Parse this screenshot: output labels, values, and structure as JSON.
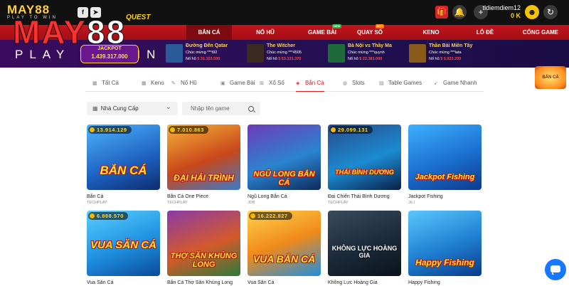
{
  "header": {
    "logo_top": "MAY88",
    "logo_bottom": "PLAY TO WIN",
    "facebook_icon": "f",
    "telegram_icon": "➤",
    "username": "tldiemdiem12",
    "balance": "0 K",
    "gift_icon": "🎁",
    "bell_icon": "🔔",
    "plus_icon": "+",
    "avatar_icon": "☻",
    "logout_icon": "↻"
  },
  "nav": {
    "quest": "QUEST",
    "items": [
      {
        "label": "BẮN CÁ",
        "active": true
      },
      {
        "label": "NỔ HŨ"
      },
      {
        "label": "GAME BÀI",
        "badge": "NEW"
      },
      {
        "label": "QUAY SỐ",
        "badge": "HOT"
      },
      {
        "label": "KENO"
      },
      {
        "label": "LÔ ĐỀ"
      },
      {
        "label": "CỔNG GAME"
      }
    ]
  },
  "brand": {
    "big_a": "MAY",
    "big_b": "88",
    "big_sub": "PLAY TO WIN"
  },
  "jackpot": {
    "label": "JACKPOT",
    "value": "1.439.317.000"
  },
  "winners": [
    {
      "title": "Đường Đến Qatar",
      "user": "Chúc mừng ***t92",
      "prefix": "Nổ hũ",
      "amount": "$ 31.103.500",
      "color": "#2a5a9a"
    },
    {
      "title": "The Witcher",
      "user": "Chúc mừng ***4505",
      "prefix": "Nổ hũ",
      "amount": "$ 53.131.370",
      "color": "#3a2a20"
    },
    {
      "title": "Bà Nội vs Thầy Ma",
      "user": "Chúc mừng ***quynh",
      "prefix": "Nổ hũ",
      "amount": "$ 22.381.000",
      "color": "#1f6a3a"
    },
    {
      "title": "Thần Bài Miền Tây",
      "user": "Chúc mừng ***lata",
      "prefix": "Nổ hũ",
      "amount": "$ 5.923.230",
      "color": "#8a5a1a"
    }
  ],
  "tabs": [
    {
      "label": "Tất Cả",
      "icon": "▦"
    },
    {
      "label": "Keno",
      "icon": "▦"
    },
    {
      "label": "Nổ Hũ",
      "icon": "✎"
    },
    {
      "label": "Game Bài",
      "icon": "▣"
    },
    {
      "label": "Xổ Số",
      "icon": "⊞"
    },
    {
      "label": "Bắn Cá",
      "icon": "◈",
      "active": true
    },
    {
      "label": "Slots",
      "icon": "◍"
    },
    {
      "label": "Table Games",
      "icon": "▤"
    },
    {
      "label": "Game Nhanh",
      "icon": "➹"
    }
  ],
  "filters": {
    "provider_label": "Nhà Cung Cấp",
    "provider_icon": "▦",
    "chevron_icon": "⌄",
    "search_placeholder": "Nhập tên game"
  },
  "side_promo": "BẮN CÁ",
  "games": [
    {
      "name": "Bắn Cá",
      "provider": "TECHPLAY",
      "jackpot": "13.914.129",
      "art": "BẮN CÁ",
      "bg": "linear-gradient(160deg,#4fb4ff,#1d5fbf 60%,#0d2d6e)"
    },
    {
      "name": "Bắn Cá One Piece",
      "provider": "TECHPLAY",
      "jackpot": "7.010.863",
      "art": "ĐẠI HẢI TRÌNH",
      "bg": "linear-gradient(160deg,#f7b23a,#c9471a 55%,#3a7bc8)"
    },
    {
      "name": "Ngũ Long Bắn Cá",
      "provider": "JDB",
      "jackpot": "",
      "art": "NGŨ LONG BẮN CÁ",
      "bg": "linear-gradient(160deg,#6e3bb8,#2a84d0 55%,#0d2a5c)"
    },
    {
      "name": "Đại Chiến Thái Bình Dương",
      "provider": "TECHPLAY",
      "jackpot": "29.099.131",
      "art": "THÁI BÌNH DƯƠNG",
      "bg": "linear-gradient(160deg,#2a4a8a,#1b8bd1 55%,#0a1f4a)"
    },
    {
      "name": "Jackpot Fishing",
      "provider": "JILI",
      "jackpot": "",
      "art": "Jackpot Fishing",
      "bg": "linear-gradient(160deg,#3fb0ff,#1b6fd0 55%,#0d3a8a)"
    },
    {
      "name": "Vua Săn Cá",
      "provider": "",
      "jackpot": "6.888.570",
      "art": "VUA SĂN CÁ",
      "bg": "linear-gradient(160deg,#5ad0ff,#1f8fe0 55%,#0a4a9a)"
    },
    {
      "name": "Bắn Cá Thợ Săn Khủng Long",
      "provider": "",
      "jackpot": "",
      "art": "THỢ SĂN KHỦNG LONG",
      "bg": "linear-gradient(160deg,#8a3aa8,#d45a2a 55%,#2a7a3a)"
    },
    {
      "name": "Vua Săn Cá",
      "provider": "",
      "jackpot": "16.222.827",
      "art": "VUA BẮN CÁ",
      "bg": "linear-gradient(160deg,#ffd24a,#f08a1a 50%,#1f8fe0)"
    },
    {
      "name": "Không Lực Hoàng Gia",
      "provider": "",
      "jackpot": "",
      "art": "KHÔNG LỰC HOÀNG GIA",
      "bg": "linear-gradient(160deg,#3a4a5a,#1a2a3a 55%,#0a121a)"
    },
    {
      "name": "Happy Fishing",
      "provider": "",
      "jackpot": "",
      "art": "Happy Fishing",
      "bg": "linear-gradient(160deg,#5ac8ff,#1f7fd0 55%,#0a3a8a)"
    }
  ]
}
